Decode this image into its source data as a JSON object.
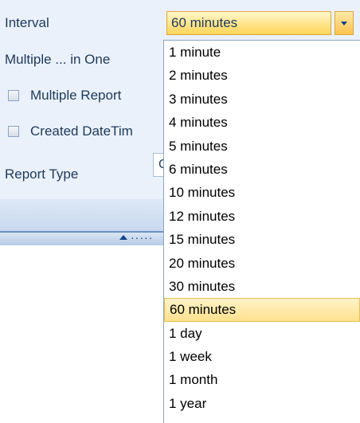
{
  "form": {
    "interval_label": "Interval",
    "multiple_in_one_label": "Multiple ... in One",
    "multiple_report_label": "Multiple Report",
    "created_datetime_label": "Created DateTim",
    "report_type_label": "Report Type",
    "report_type_value": "C"
  },
  "interval_combo": {
    "value": "60 minutes",
    "options": [
      "1 minute",
      "2 minutes",
      "3 minutes",
      "4 minutes",
      "5 minutes",
      "6 minutes",
      "10 minutes",
      "12 minutes",
      "15 minutes",
      "20 minutes",
      "30 minutes",
      "60 minutes",
      "1 day",
      "1 week",
      "1 month",
      "1 year"
    ],
    "selected_index": 11
  },
  "splitter": {
    "dots": "·····"
  },
  "colors": {
    "highlight": "#ffe18e",
    "highlight_border": "#e8bf55",
    "label_text": "#1e395b",
    "panel_bg": "#eaf1fb"
  }
}
